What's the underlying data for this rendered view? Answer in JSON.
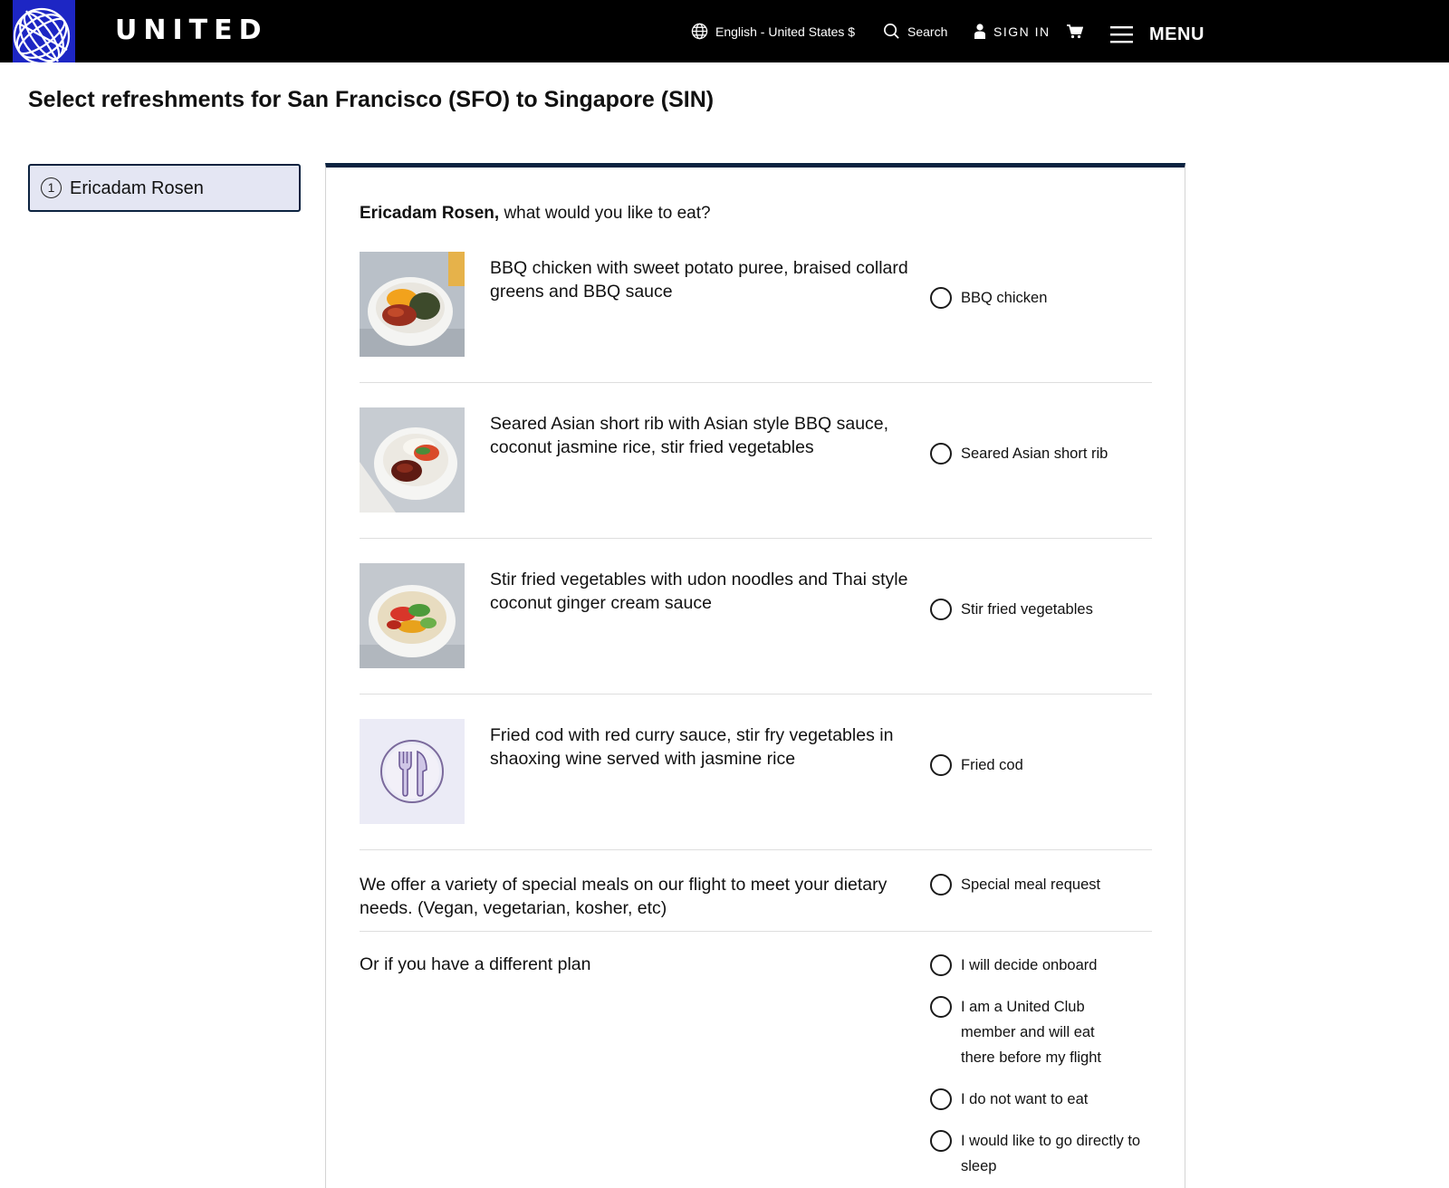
{
  "header": {
    "brand": "UNITED",
    "language_label": "English - United States $",
    "search_label": "Search",
    "signin_label": "SIGN IN",
    "menu_label": "MENU",
    "brand_color": "#1d26c4"
  },
  "page": {
    "title": "Select refreshments for San Francisco (SFO) to Singapore (SIN)"
  },
  "passenger": {
    "number": "1",
    "name": "Ericadam Rosen"
  },
  "question": {
    "name": "Ericadam Rosen,",
    "text": " what would you like to eat?"
  },
  "meals": [
    {
      "description": "BBQ chicken with sweet potato puree, braised collard greens and BBQ sauce",
      "option": "BBQ chicken",
      "image": "bbq-chicken-dish"
    },
    {
      "description": "Seared Asian short rib with Asian style BBQ sauce, coconut jasmine rice, stir fried vegetables",
      "option": "Seared Asian short rib",
      "image": "short-rib-dish"
    },
    {
      "description": "Stir fried vegetables with udon noodles and Thai style coconut ginger cream sauce",
      "option": "Stir fried vegetables",
      "image": "stir-fry-dish"
    },
    {
      "description": "Fried cod with red curry sauce, stir fry vegetables in shaoxing wine served with jasmine rice",
      "option": "Fried cod",
      "image": "fork-knife-placeholder"
    }
  ],
  "special": {
    "text": "We offer a variety of special meals on our flight to meet your dietary needs. (Vegan, vegetarian, kosher, etc)",
    "option": "Special meal request"
  },
  "other": {
    "text": "Or if you have a different plan",
    "options": [
      "I will decide onboard",
      "I am a United Club member and will eat there before my flight",
      "I do not want to eat",
      "I would like to go directly to sleep"
    ]
  }
}
